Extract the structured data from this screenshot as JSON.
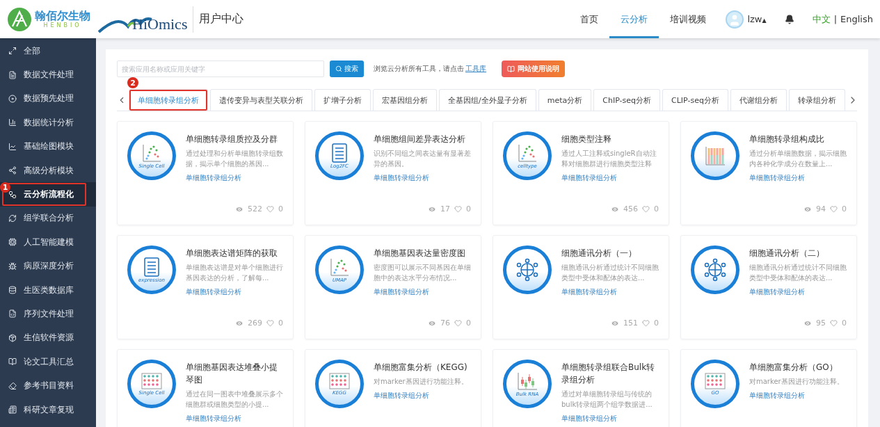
{
  "header": {
    "brand": {
      "name": "翰佰尔生物",
      "latin": "HENBIO"
    },
    "product": "HiOmics",
    "section": "用户中心",
    "nav": [
      {
        "label": "首页",
        "selected": false
      },
      {
        "label": "云分析",
        "selected": true
      },
      {
        "label": "培训视频",
        "selected": false
      }
    ],
    "user": {
      "name": "lzw",
      "caret": "▲"
    },
    "languages": [
      {
        "label": "中文",
        "selected": true
      },
      {
        "label": "English",
        "selected": false
      }
    ],
    "language_separator": "|"
  },
  "sidebar": {
    "items": [
      {
        "label": "全部",
        "selected": false
      },
      {
        "label": "数据文件处理",
        "selected": false
      },
      {
        "label": "数据预先处理",
        "selected": false
      },
      {
        "label": "数据统计分析",
        "selected": false
      },
      {
        "label": "基础绘图模块",
        "selected": false
      },
      {
        "label": "高级分析模块",
        "selected": false
      },
      {
        "label": "云分析流程化",
        "selected": true,
        "annotation": "1"
      },
      {
        "label": "组学联合分析",
        "selected": false
      },
      {
        "label": "人工智能建模",
        "selected": false
      },
      {
        "label": "病原深度分析",
        "selected": false
      },
      {
        "label": "生医类数据库",
        "selected": false
      },
      {
        "label": "序列文件处理",
        "selected": false
      },
      {
        "label": "生信软件资源",
        "selected": false
      },
      {
        "label": "论文工具汇总",
        "selected": false
      },
      {
        "label": "参考书目资料",
        "selected": false
      },
      {
        "label": "科研文章复现",
        "selected": false
      }
    ]
  },
  "search": {
    "placeholder": "搜索应用名称或应用关键字",
    "button": "搜索",
    "hint": "浏览云分析所有工具，请点击",
    "link": "工具库",
    "guide_button": "网站使用说明"
  },
  "tabs": [
    {
      "label": "单细胞转录组分析",
      "selected": true,
      "annotation": "2"
    },
    {
      "label": "遗传变异与表型关联分析",
      "selected": false
    },
    {
      "label": "扩增子分析",
      "selected": false
    },
    {
      "label": "宏基因组分析",
      "selected": false
    },
    {
      "label": "全基因组/全外显子分析",
      "selected": false
    },
    {
      "label": "meta分析",
      "selected": false
    },
    {
      "label": "ChIP-seq分析",
      "selected": false
    },
    {
      "label": "CLIP-seq分析",
      "selected": false
    },
    {
      "label": "代谢组分析",
      "selected": false
    },
    {
      "label": "转录组分析",
      "selected": false
    }
  ],
  "cards": [
    {
      "title": "单细胞转录组质控及分群",
      "description": "通过处理和分析单细胞转录组数据，揭示单个细胞的基因...",
      "tag": "单细胞转录组分析",
      "views": "522",
      "likes": "0",
      "icon": {
        "kind": "scatter",
        "label": "Single Cell"
      }
    },
    {
      "title": "单细胞组间差异表达分析",
      "description": "识别不同组之间表达量有显著差异的基因。",
      "tag": "单细胞转录组分析",
      "views": "17",
      "likes": "0",
      "icon": {
        "kind": "list",
        "label": "Log2FC"
      }
    },
    {
      "title": "细胞类型注释",
      "description": "通过人工注释或singleR自动注释对细胞群进行细胞类型注释",
      "tag": "单细胞转录组分析",
      "views": "456",
      "likes": "0",
      "icon": {
        "kind": "scatter",
        "label": "celltype"
      }
    },
    {
      "title": "单细胞转录组构成比",
      "description": "通过分析单细胞数据，揭示细胞内各种化学成分在数量上...",
      "tag": "单细胞转录组分析",
      "views": "94",
      "likes": "0",
      "icon": {
        "kind": "bars"
      }
    },
    {
      "title": "单细胞表达谱矩阵的获取",
      "description": "单细胞表达谱是对单个细胞进行基因表达的分析，了解每...",
      "tag": "单细胞转录组分析",
      "views": "269",
      "likes": "0",
      "icon": {
        "kind": "list",
        "label": "expression"
      }
    },
    {
      "title": "单细胞基因表达量密度图",
      "description": "密度图可以展示不同基因在单细胞中的表达水平分布情况...",
      "tag": "单细胞转录组分析",
      "views": "76",
      "likes": "0",
      "icon": {
        "kind": "scatter",
        "label": "UMAP"
      }
    },
    {
      "title": "细胞通讯分析（一）",
      "description": "细胞通讯分析通过统计不同细胞类型中受体和配体的表达...",
      "tag": "单细胞转录组分析",
      "views": "151",
      "likes": "0",
      "icon": {
        "kind": "network"
      }
    },
    {
      "title": "细胞通讯分析（二）",
      "description": "细胞通讯分析通过统计不同细胞类型中受体和配体的表达...",
      "tag": "单细胞转录组分析",
      "views": "95",
      "likes": "0",
      "icon": {
        "kind": "network"
      }
    },
    {
      "title": "单细胞基因表达堆叠小提琴图",
      "description": "通过在同一图表中堆叠展示多个细胞群或细胞类型的小提...",
      "tag": "单细胞转录组分析",
      "icon": {
        "kind": "dots",
        "label": "Single Cell"
      }
    },
    {
      "title": "单细胞富集分析（KEGG)",
      "description": "对marker基因进行功能注释。",
      "tag": "单细胞转录组分析",
      "icon": {
        "kind": "dots",
        "label": "KEGG"
      }
    },
    {
      "title": "单细胞转录组联合Bulk转录组分析",
      "description": "通过对单细胞转录组与传统的bulk转录组两个组学数据进...",
      "tag": "单细胞转录组分析",
      "icon": {
        "kind": "candles",
        "label": "Bulk RNA"
      }
    },
    {
      "title": "单细胞富集分析（GO）",
      "description": "对marker基因进行功能注释。",
      "tag": "单细胞转录组分析",
      "icon": {
        "kind": "dots",
        "label": "GO"
      }
    }
  ]
}
